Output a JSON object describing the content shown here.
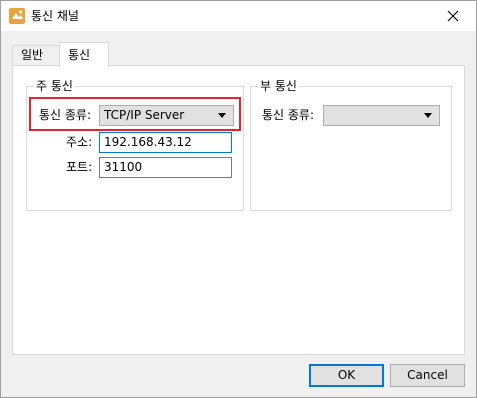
{
  "window": {
    "title": "통신 채널"
  },
  "tabs": [
    {
      "label": "일반",
      "active": false
    },
    {
      "label": "통신",
      "active": true
    }
  ],
  "primary": {
    "legend": "주 통신",
    "type_label": "통신 종류:",
    "type_value": "TCP/IP Server",
    "address_label": "주소:",
    "address_value": "192.168.43.12",
    "port_label": "포트:",
    "port_value": "31100"
  },
  "secondary": {
    "legend": "부 통신",
    "type_label": "통신 종류:",
    "type_value": ""
  },
  "buttons": {
    "ok": "OK",
    "cancel": "Cancel"
  },
  "colors": {
    "highlight": "#e0262b",
    "focus": "#0078d7"
  }
}
